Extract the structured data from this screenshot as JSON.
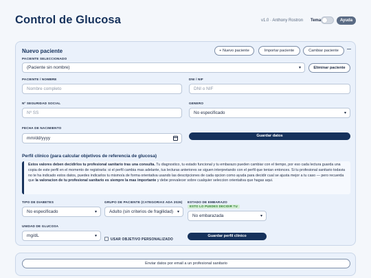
{
  "header": {
    "title": "Control de Glucosa",
    "version": "v1.0 · Anthony Rostron",
    "theme_label": "Tema",
    "help_label": "Ayuda"
  },
  "patient": {
    "section_title": "Nuevo paciente",
    "new_patient_button": "+ Nuevo paciente",
    "import_button": "Importar paciente",
    "switch_button": "Cambiar paciente",
    "collapse_icon": "minus-icon",
    "selected_label": "PACIENTE SELECCIONADO",
    "selected_value": "(Paciente sin nombre)",
    "delete_button": "Eliminar paciente",
    "name_label": "PACIENTE / NOMBRE",
    "name_placeholder": "Nombre completo",
    "dni_label": "DNI / NIF",
    "dni_placeholder": "DNI o NIF",
    "ss_label": "Nº SEGURIDAD SOCIAL",
    "ss_placeholder": "Nº SS",
    "gender_label": "GENERO",
    "gender_value": "No especificado",
    "birth_label": "FECHA DE NACIMIENTO",
    "birth_placeholder": "mm/dd/yyyy",
    "save_button": "Guardar datos"
  },
  "profile": {
    "section_title": "Perfil clínico (para calcular objetivos de referencia de glucosa)",
    "info_bold_1": "Estos valores deben decidirlos tu profesional sanitario tras una consulta.",
    "info_text_1": " Tu diagnostico, tu estado funcional y tu embarazo pueden cambiar con el tiempo, por eso cada lectura guarda una copia de este perfil en el momento de registrarla: si el perfil cambia mas adelante, tus lecturas anteriores se siguen interpretando con el perfil que tenian entonces. Si tu profesional sanitario todavia no te ha indicado estos datos, puedes indicarlos tu mismo/a de forma orientativa usando las descripciones de cada opcion como ayuda para decidir cual se ajusta mejor a tu caso — pero recuerda que ",
    "info_bold_2": "la valoracion de tu profesional sanitario es siempre la mas importante",
    "info_text_2": " y debe prevalecer sobre cualquier seleccion orientativa que hagas aqui.",
    "diabetes_label": "TIPO DE DIABETES",
    "diabetes_value": "No especificado",
    "group_label": "GRUPO DE PACIENTE (CATEGORIAS ADA 2026)",
    "group_value": "Adulto (sin criterios de fragilidad)",
    "pregnancy_label": "ESTADO DE EMBARAZO",
    "pregnancy_badge": "ESTO LO PUEDES DECIDIR TU",
    "pregnancy_value": "No embarazada",
    "unit_label": "UNIDAD DE GLUCOSA",
    "unit_value": "mg/dL",
    "custom_target_label": "USAR OBJETIVO PERSONALIZADO",
    "save_profile_button": "Guardar perfil clínico"
  },
  "footer": {
    "email_button": "Enviar datos por email a un profesional sanitario"
  }
}
